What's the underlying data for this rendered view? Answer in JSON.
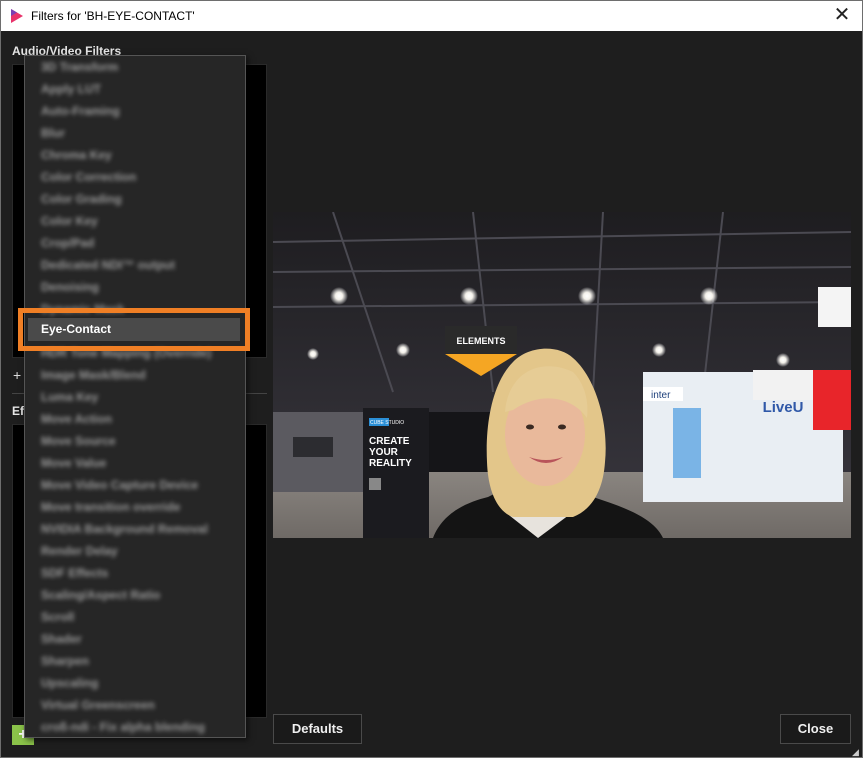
{
  "window": {
    "title": "Filters for 'BH-EYE-CONTACT'",
    "close_glyph": "✕"
  },
  "left": {
    "av_filters_label": "Audio/Video Filters",
    "effects_label": "Ef",
    "add_glyph": "+",
    "small_add_glyph": "+"
  },
  "menu": {
    "items": [
      "3D Transform",
      "Apply LUT",
      "Auto-Framing",
      "Blur",
      "Chroma Key",
      "Color Correction",
      "Color Grading",
      "Color Key",
      "Crop/Pad",
      "Dedicated NDI™ output",
      "Denoising",
      "Dynamic Mask",
      "Eye-Contact",
      "HDR Tone Mapping (Override)",
      "Image Mask/Blend",
      "Luma Key",
      "Move Action",
      "Move Source",
      "Move Value",
      "Move Video Capture Device",
      "Move transition override",
      "NVIDIA Background Removal",
      "Render Delay",
      "SDF Effects",
      "Scaling/Aspect Ratio",
      "Scroll",
      "Shader",
      "Sharpen",
      "Upscaling",
      "Virtual Greenscreen",
      "croß-ndi - Fix alpha blending"
    ],
    "selected": "Eye-Contact"
  },
  "preview": {
    "booth_sign": "ELEMENTS",
    "poster_brand": "CUBE STUDIO",
    "poster_line1": "CREATE",
    "poster_line2": "YOUR",
    "poster_line3": "REALITY",
    "liveu_sign": "LiveU",
    "inter_sign": "inter"
  },
  "buttons": {
    "defaults": "Defaults",
    "close": "Close"
  },
  "colors": {
    "accent_orange": "#f07f25",
    "add_green": "#8bc34a"
  }
}
